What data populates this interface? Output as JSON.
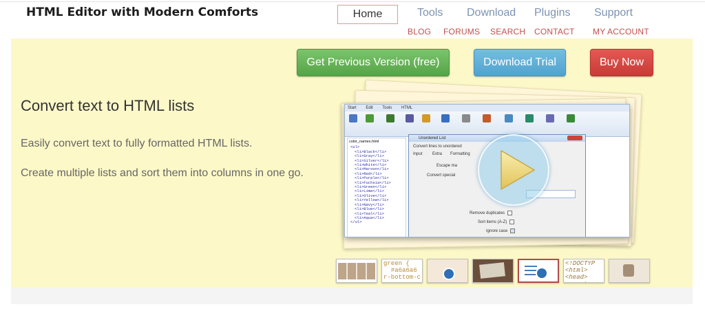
{
  "site": {
    "title": "HTML Editor with Modern Comforts"
  },
  "nav": {
    "tabs": [
      "Home",
      "Tools",
      "Download",
      "Plugins",
      "Support"
    ],
    "sub_links": [
      "BLOG",
      "FORUMS",
      "SEARCH",
      "CONTACT",
      "MY ACCOUNT"
    ]
  },
  "cta": {
    "previous_version": "Get Previous Version (free)",
    "download_trial": "Download Trial",
    "buy_now": "Buy Now"
  },
  "hero": {
    "headline": "Convert text to HTML lists",
    "paragraph_1": "Easily convert text to fully formatted HTML lists.",
    "paragraph_2": "Create multiple lists and sort them into columns in one go."
  },
  "screenshot": {
    "ribbon_tabs": [
      "Start",
      "Edit",
      "Tools",
      "HTML"
    ],
    "file_tab": "color_names.html",
    "code_lines": [
      "<ul>",
      "<li>Black</li>",
      "<li>Gray</li>",
      "<li>Silver</li>",
      "<li>White</li>",
      "<li>Maroon</li>",
      "<li>Red</li>",
      "<li>Purple</li>",
      "<li>Fuchsia</li>",
      "<li>Green</li>",
      "<li>Lime</li>",
      "<li>Olive</li>",
      "<li>Yellow</li>",
      "<li>Navy</li>",
      "<li>Blue</li>",
      "<li>Teal</li>",
      "<li>Aqua</li>",
      "</ul>"
    ],
    "dialog_title": "Unordered List",
    "dialog_heading": "Convert lines to unordered",
    "dialog_tabs": [
      "Input",
      "Extra",
      "Formatting"
    ],
    "escape_label": "Escape ma",
    "convert_label": "Convert special",
    "remove_duplicates": "Remove duplicates",
    "sort_items": "Sort items (A-Z)",
    "ignore_case": "Ignore case"
  },
  "thumbnails": [
    {
      "icon": "grid-thumbnail",
      "text": ""
    },
    {
      "icon": "code-thumbnail",
      "text": "green {\n  #a6a6a6\nr-bottom-c"
    },
    {
      "icon": "search-thumbnail",
      "text": ""
    },
    {
      "icon": "editor-thumbnail",
      "text": ""
    },
    {
      "icon": "list-thumbnail",
      "text": ""
    },
    {
      "icon": "doctype-thumbnail",
      "text": "<!DOCTYP\n<html> \n<head>\n  <met"
    },
    {
      "icon": "image-thumbnail",
      "text": ""
    }
  ],
  "colors": {
    "hero_bg": "#fcf8c8",
    "green": "#5fae50",
    "blue": "#5aabd6",
    "red": "#d3443f",
    "nav_link": "#7b93b3",
    "sub_link": "#c0504d"
  }
}
